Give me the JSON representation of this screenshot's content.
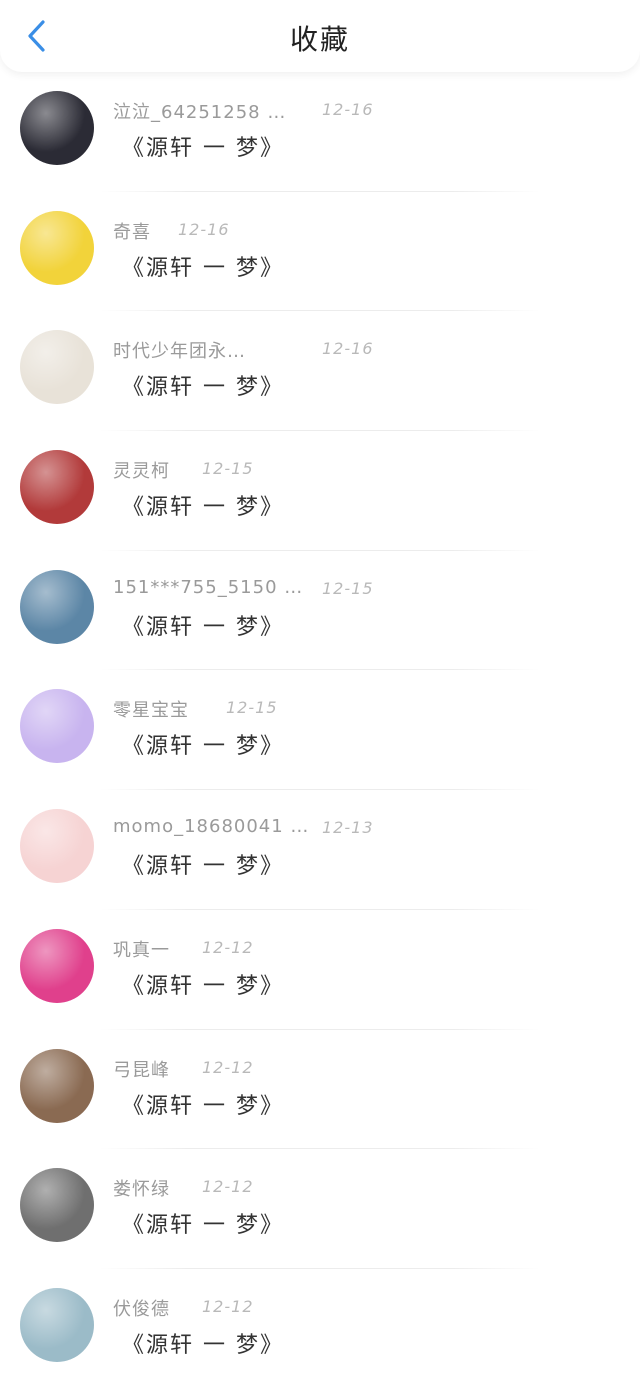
{
  "header": {
    "title": "收藏",
    "back_icon": "chevron-left-icon",
    "accent": "#3a8ee6"
  },
  "items": [
    {
      "name": "泣泣_64251258 …",
      "date": "12-16",
      "content": "《源轩 一 梦》",
      "avatar_color": "#2b2b35"
    },
    {
      "name": "奇喜",
      "date": "12-16",
      "content": "《源轩 一 梦》",
      "avatar_color": "#f2d33a"
    },
    {
      "name": "时代少年团永…",
      "date": "12-16",
      "content": "《源轩 一 梦》",
      "avatar_color": "#e8e2d8"
    },
    {
      "name": "灵灵柯",
      "date": "12-15",
      "content": "《源轩 一 梦》",
      "avatar_color": "#b23a3a"
    },
    {
      "name": "151***755_5150 …",
      "date": "12-15",
      "content": "《源轩 一 梦》",
      "avatar_color": "#5c86a6"
    },
    {
      "name": "零星宝宝",
      "date": "12-15",
      "content": "《源轩 一 梦》",
      "avatar_color": "#c8b4ef"
    },
    {
      "name": "momo_18680041 …",
      "date": "12-13",
      "content": "《源轩 一 梦》",
      "avatar_color": "#f6d3d3"
    },
    {
      "name": "巩真一",
      "date": "12-12",
      "content": "《源轩 一 梦》",
      "avatar_color": "#e0408c"
    },
    {
      "name": "弓昆峰",
      "date": "12-12",
      "content": "《源轩 一 梦》",
      "avatar_color": "#8a6a52"
    },
    {
      "name": "娄怀绿",
      "date": "12-12",
      "content": "《源轩 一 梦》",
      "avatar_color": "#6f6f6f"
    },
    {
      "name": "伏俊德",
      "date": "12-12",
      "content": "《源轩 一 梦》",
      "avatar_color": "#9bbbc8"
    }
  ]
}
